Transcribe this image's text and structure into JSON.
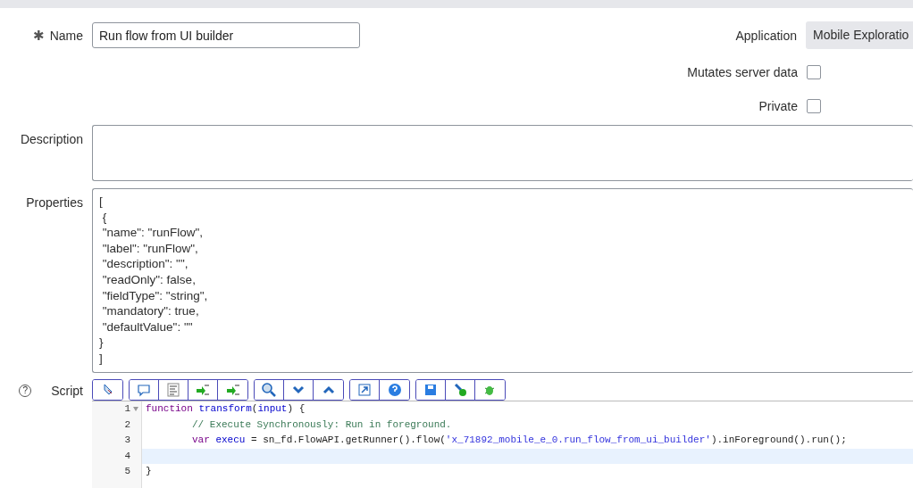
{
  "name_field": {
    "required_mark": "✱",
    "label": "Name",
    "value": "Run flow from UI builder"
  },
  "application": {
    "label": "Application",
    "value": "Mobile Exploratio"
  },
  "checkboxes": [
    {
      "label": "Mutates server data",
      "checked": false
    },
    {
      "label": "Private",
      "checked": false
    }
  ],
  "description": {
    "label": "Description"
  },
  "properties": {
    "label": "Properties",
    "value": "[\n {\n \"name\": \"runFlow\",\n \"label\": \"runFlow\",\n \"description\": \"\",\n \"readOnly\": false,\n \"fieldType\": \"string\",\n \"mandatory\": true,\n \"defaultValue\": \"\"\n}\n]"
  },
  "script": {
    "label": "Script",
    "help": "?",
    "lines": [
      {
        "number": "1",
        "fold": true,
        "indented": false,
        "active": false,
        "tokens": [
          {
            "kind": "keyword",
            "text": "function"
          },
          {
            "kind": "name",
            "text": " transform"
          },
          {
            "kind": "plain",
            "text": "("
          },
          {
            "kind": "name",
            "text": "input"
          },
          {
            "kind": "plain",
            "text": ") {"
          }
        ]
      },
      {
        "number": "2",
        "fold": false,
        "indented": true,
        "active": false,
        "tokens": [
          {
            "kind": "comment",
            "text": "// Execute Synchronously: Run in foreground."
          }
        ]
      },
      {
        "number": "3",
        "fold": false,
        "indented": true,
        "active": false,
        "tokens": [
          {
            "kind": "keyword",
            "text": "var"
          },
          {
            "kind": "name",
            "text": " execu"
          },
          {
            "kind": "plain",
            "text": " = sn_fd.FlowAPI.getRunner().flow("
          },
          {
            "kind": "string",
            "text": "'x_71892_mobile_e_0.run_flow_from_ui_builder'"
          },
          {
            "kind": "plain",
            "text": ").inForeground().run();"
          }
        ]
      },
      {
        "number": "4",
        "fold": false,
        "indented": false,
        "active": true
      },
      {
        "number": "5",
        "fold": false,
        "indented": false,
        "active": false,
        "tokens": [
          {
            "kind": "plain",
            "text": "}"
          }
        ]
      }
    ]
  }
}
